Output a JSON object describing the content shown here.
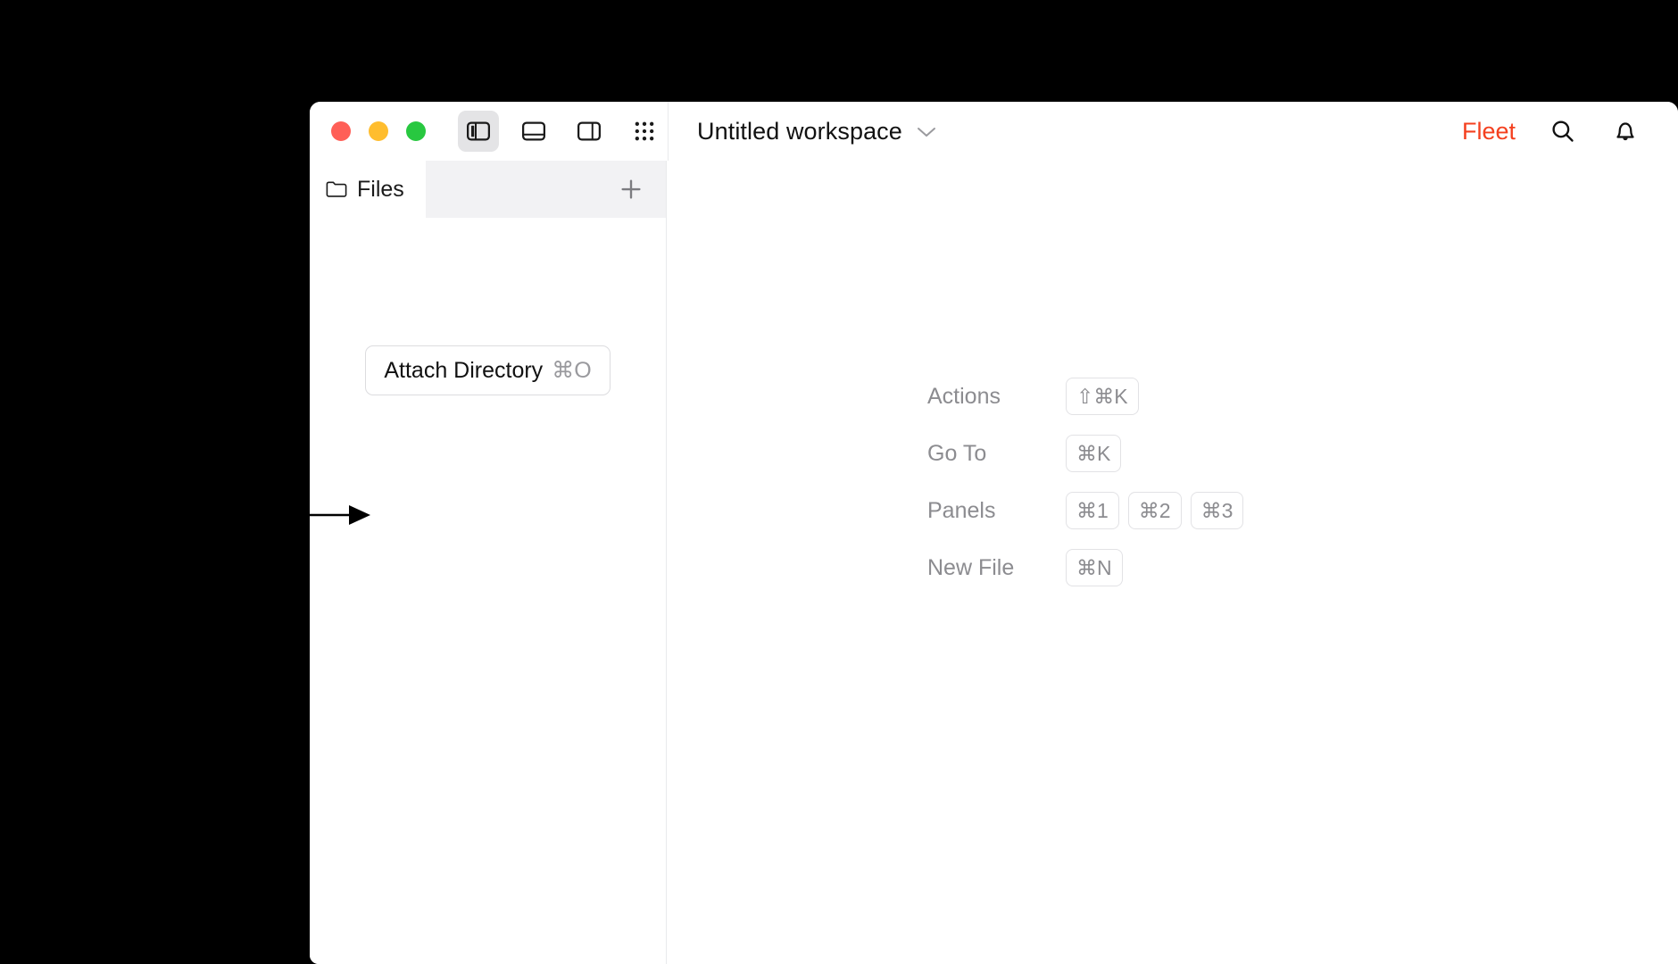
{
  "window": {
    "titlebar": {
      "traffic_lights": [
        {
          "name": "close",
          "color": "#ff5f57"
        },
        {
          "name": "minimize",
          "color": "#ffbd2e"
        },
        {
          "name": "zoom",
          "color": "#28c840"
        }
      ],
      "panel_toggles": [
        {
          "name": "left-panel-toggle",
          "active": true
        },
        {
          "name": "bottom-panel-toggle",
          "active": false
        },
        {
          "name": "right-panel-toggle",
          "active": false
        },
        {
          "name": "grid-menu",
          "active": false
        }
      ],
      "workspace_title": "Untitled workspace",
      "brand_label": "Fleet",
      "brand_color": "#f4401f",
      "right_icons": [
        "search-icon",
        "notifications-icon"
      ]
    },
    "sidebar": {
      "tab": {
        "label": "Files",
        "icon": "folder-icon"
      },
      "add_tab_label": "+",
      "attach_button": {
        "label": "Attach Directory",
        "shortcut": "⌘O"
      }
    },
    "editor": {
      "shortcuts": [
        {
          "label": "Actions",
          "keys": [
            "⇧⌘K"
          ]
        },
        {
          "label": "Go To",
          "keys": [
            "⌘K"
          ]
        },
        {
          "label": "Panels",
          "keys": [
            "⌘1",
            "⌘2",
            "⌘3"
          ]
        },
        {
          "label": "New File",
          "keys": [
            "⌘N"
          ]
        }
      ]
    }
  },
  "annotation": {
    "arrow": "points-right-to-sidebar"
  }
}
